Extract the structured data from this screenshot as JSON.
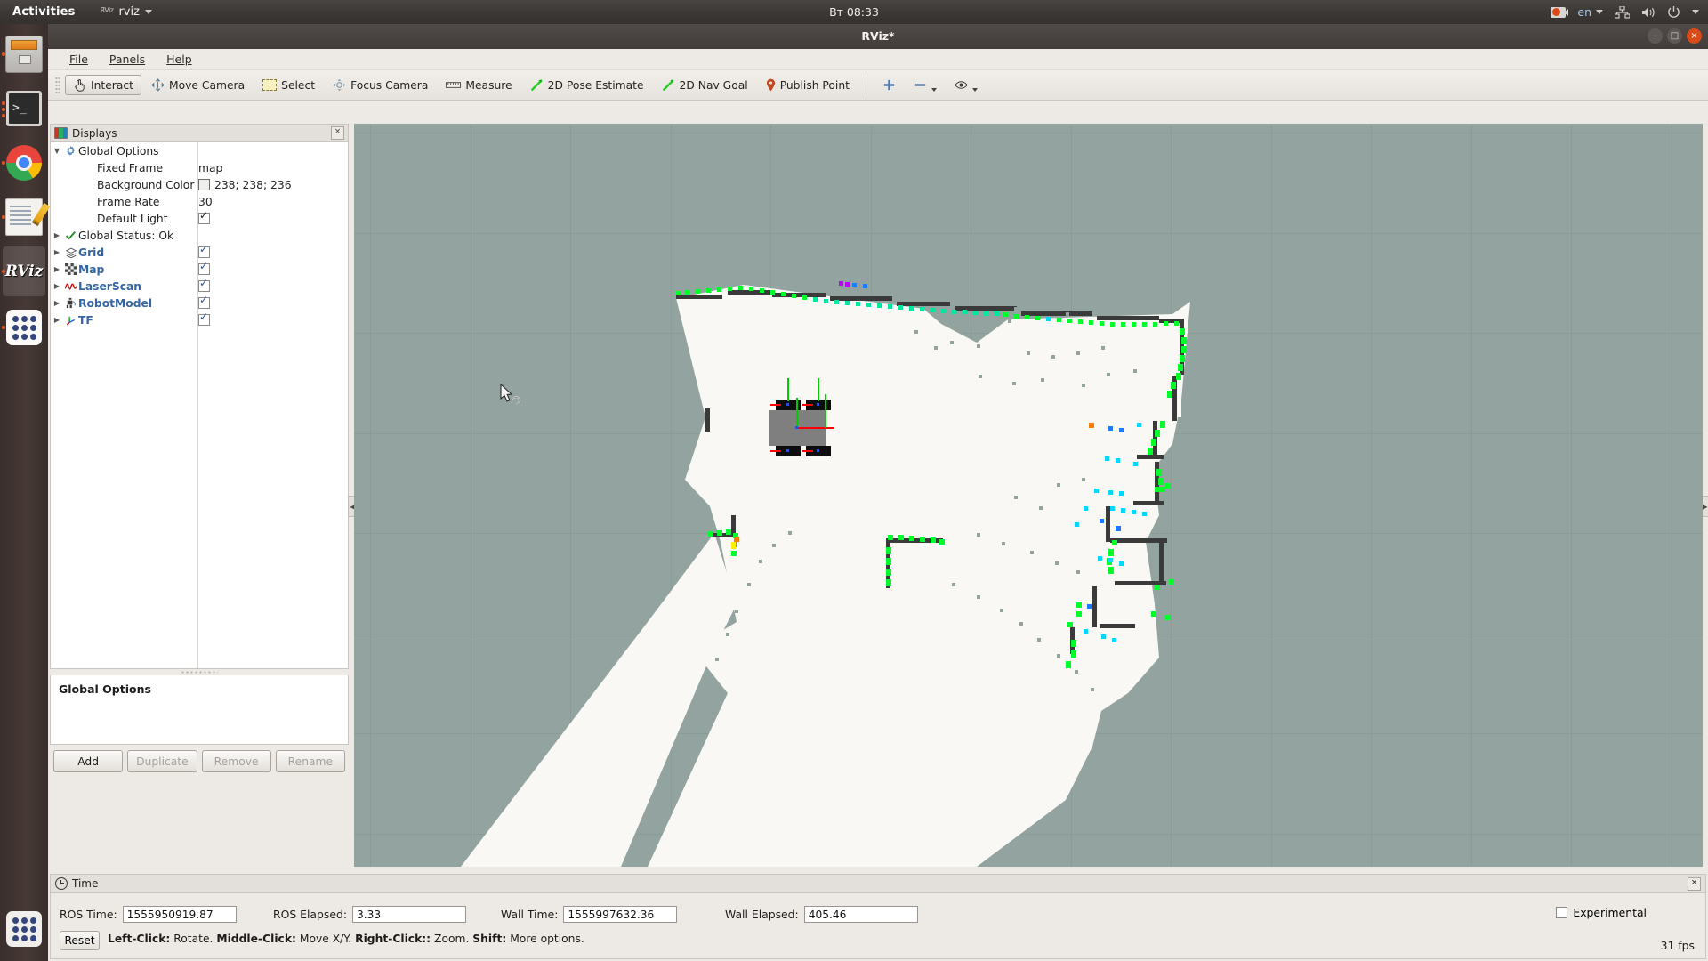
{
  "desktop": {
    "activities_label": "Activities",
    "app_indicator_prefix": "RViz",
    "app_indicator_name": "rviz",
    "clock": "Вт 08:33",
    "language": "en",
    "launcher": [
      {
        "name": "files",
        "label": "Files"
      },
      {
        "name": "terminal",
        "label": "Terminal"
      },
      {
        "name": "chrome",
        "label": "Google Chrome"
      },
      {
        "name": "text-editor",
        "label": "Text Editor"
      },
      {
        "name": "rviz",
        "label": "RViz"
      },
      {
        "name": "show-applications",
        "label": "Show Applications"
      }
    ]
  },
  "window": {
    "title": "RViz*",
    "minimize": "–",
    "maximize": "□",
    "close": "×"
  },
  "menubar": [
    "File",
    "Panels",
    "Help"
  ],
  "toolbar": {
    "buttons": [
      {
        "label": "Interact",
        "icon": "hand-icon",
        "active": true
      },
      {
        "label": "Move Camera",
        "icon": "move-camera-icon",
        "active": false
      },
      {
        "label": "Select",
        "icon": "select-rect-icon",
        "active": false
      },
      {
        "label": "Focus Camera",
        "icon": "focus-camera-icon",
        "active": false
      },
      {
        "label": "Measure",
        "icon": "ruler-icon",
        "active": false
      },
      {
        "label": "2D Pose Estimate",
        "icon": "pose-arrow-icon",
        "active": false
      },
      {
        "label": "2D Nav Goal",
        "icon": "nav-goal-arrow-icon",
        "active": false
      },
      {
        "label": "Publish Point",
        "icon": "map-pin-icon",
        "active": false
      }
    ],
    "extra": [
      {
        "name": "add-tool-icon",
        "glyph": "+"
      },
      {
        "name": "remove-tool-icon",
        "glyph": "–"
      },
      {
        "name": "tool-properties-icon",
        "glyph": "◉"
      }
    ]
  },
  "displays": {
    "panel_title": "Displays",
    "close_glyph": "×",
    "tree": [
      {
        "label": "Global Options",
        "indent": 0,
        "arrow": "▼",
        "icon": "gear-icon",
        "style": "plain",
        "value": "",
        "control": "none"
      },
      {
        "label": "Fixed Frame",
        "indent": 1,
        "arrow": "",
        "icon": "",
        "style": "plain",
        "value": "map",
        "control": "text"
      },
      {
        "label": "Background Color",
        "indent": 1,
        "arrow": "",
        "icon": "",
        "style": "plain",
        "value": "238; 238; 236",
        "control": "swatch"
      },
      {
        "label": "Frame Rate",
        "indent": 1,
        "arrow": "",
        "icon": "",
        "style": "plain",
        "value": "30",
        "control": "text"
      },
      {
        "label": "Default Light",
        "indent": 1,
        "arrow": "",
        "icon": "",
        "style": "plain",
        "value": "",
        "control": "checkbox-dark"
      },
      {
        "label": "Global Status: Ok",
        "indent": 0,
        "arrow": "▶",
        "icon": "check-icon",
        "style": "plain",
        "value": "",
        "control": "none"
      },
      {
        "label": "Grid",
        "indent": 0,
        "arrow": "▶",
        "icon": "grid-icon",
        "style": "blue",
        "value": "",
        "control": "checkbox"
      },
      {
        "label": "Map",
        "indent": 0,
        "arrow": "▶",
        "icon": "map-icon",
        "style": "blue",
        "value": "",
        "control": "checkbox"
      },
      {
        "label": "LaserScan",
        "indent": 0,
        "arrow": "▶",
        "icon": "laserscan-icon",
        "style": "blue",
        "value": "",
        "control": "checkbox"
      },
      {
        "label": "RobotModel",
        "indent": 0,
        "arrow": "▶",
        "icon": "robotmodel-icon",
        "style": "blue",
        "value": "",
        "control": "checkbox"
      },
      {
        "label": "TF",
        "indent": 0,
        "arrow": "▶",
        "icon": "tf-axes-icon",
        "style": "blue",
        "value": "",
        "control": "checkbox"
      }
    ],
    "selected_property": "Global Options",
    "buttons": [
      {
        "label": "Add",
        "enabled": true
      },
      {
        "label": "Duplicate",
        "enabled": false
      },
      {
        "label": "Remove",
        "enabled": false
      },
      {
        "label": "Rename",
        "enabled": false
      }
    ]
  },
  "time_panel": {
    "title": "Time",
    "close_glyph": "×",
    "fields": [
      {
        "label": "ROS Time:",
        "value": "1555950919.87"
      },
      {
        "label": "ROS Elapsed:",
        "value": "3.33"
      },
      {
        "label": "Wall Time:",
        "value": "1555997632.36"
      },
      {
        "label": "Wall Elapsed:",
        "value": "405.46"
      }
    ],
    "reset_label": "Reset",
    "hint_parts": [
      {
        "t": "Left-Click:",
        "b": true
      },
      {
        "t": " Rotate. ",
        "b": false
      },
      {
        "t": "Middle-Click:",
        "b": true
      },
      {
        "t": " Move X/Y. ",
        "b": false
      },
      {
        "t": "Right-Click::",
        "b": true
      },
      {
        "t": " Zoom. ",
        "b": false
      },
      {
        "t": "Shift:",
        "b": true
      },
      {
        "t": " More options.",
        "b": false
      }
    ],
    "experimental_label": "Experimental",
    "experimental_checked": false,
    "fps": "31 fps"
  },
  "viewport": {
    "background_color": "#93a3a0",
    "grid_line_color": "#8b9b98",
    "map_free_color": "#f9f8f5",
    "map_occupied_color": "#3a3a3a",
    "map_unknown_color": "#93a3a0",
    "laser_colors": [
      "#00ff2a",
      "#00e8a0",
      "#00d8ff",
      "#1e7dff",
      "#ff8800",
      "#ffee00",
      "#c000ff"
    ],
    "robot_body_color": "#7f7f7f",
    "robot_wheel_color": "#0d0d0d",
    "tf_axis_x_color": "#ff0000",
    "tf_axis_y_color": "#00cc00",
    "cursor_hint": "rotate-cursor"
  }
}
